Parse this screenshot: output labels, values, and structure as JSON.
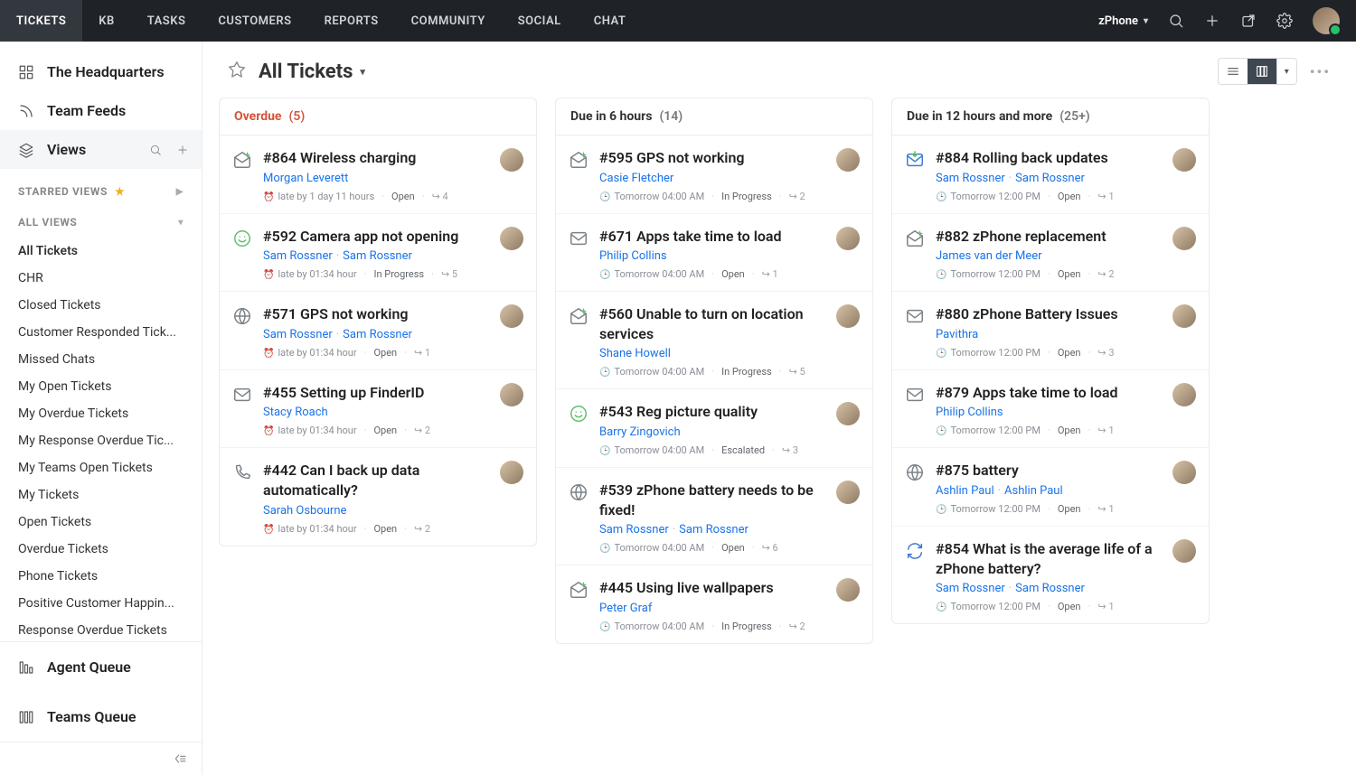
{
  "nav": {
    "tabs": [
      "TICKETS",
      "KB",
      "TASKS",
      "CUSTOMERS",
      "REPORTS",
      "COMMUNITY",
      "SOCIAL",
      "CHAT"
    ],
    "brand": "zPhone"
  },
  "sidebar": {
    "headquarters": "The Headquarters",
    "teamFeeds": "Team Feeds",
    "views": "Views",
    "starredViews": "STARRED VIEWS",
    "allViewsHeader": "ALL VIEWS",
    "allViews": [
      "All Tickets",
      "CHR",
      "Closed Tickets",
      "Customer Responded Tick...",
      "Missed Chats",
      "My Open Tickets",
      "My Overdue Tickets",
      "My Response Overdue Tic...",
      "My Teams Open Tickets",
      "My Tickets",
      "Open Tickets",
      "Overdue Tickets",
      "Phone Tickets",
      "Positive Customer Happin...",
      "Response Overdue Tickets"
    ],
    "agentQueue": "Agent Queue",
    "teamsQueue": "Teams Queue"
  },
  "header": {
    "title": "All Tickets"
  },
  "columns": [
    {
      "title": "Overdue",
      "count": "(5)",
      "overdue": true,
      "cards": [
        {
          "icon": "email-open",
          "id": "#864",
          "title": "Wireless charging",
          "assignees": [
            "Morgan Leverett"
          ],
          "late": "late by 1 day 11 hours",
          "status": "Open",
          "flag": "4"
        },
        {
          "icon": "smiley",
          "id": "#592",
          "title": "Camera app not opening",
          "assignees": [
            "Sam Rossner",
            "Sam Rossner"
          ],
          "late": "late by 01:34 hour",
          "status": "In Progress",
          "flag": "5"
        },
        {
          "icon": "globe",
          "id": "#571",
          "title": "GPS not working",
          "assignees": [
            "Sam Rossner",
            "Sam Rossner"
          ],
          "late": "late by 01:34 hour",
          "status": "Open",
          "flag": "1"
        },
        {
          "icon": "email",
          "id": "#455",
          "title": "Setting up FinderID",
          "assignees": [
            "Stacy Roach"
          ],
          "late": "late by 01:34 hour",
          "status": "Open",
          "flag": "2"
        },
        {
          "icon": "phone",
          "id": "#442",
          "title": "Can I back up data automatically?",
          "assignees": [
            "Sarah Osbourne"
          ],
          "late": "late by 01:34 hour",
          "status": "Open",
          "flag": "2"
        }
      ]
    },
    {
      "title": "Due in 6 hours",
      "count": "(14)",
      "cards": [
        {
          "icon": "email-open",
          "id": "#595",
          "title": "GPS not working",
          "assignees": [
            "Casie Fletcher"
          ],
          "due": "Tomorrow 04:00 AM",
          "status": "In Progress",
          "flag": "2"
        },
        {
          "icon": "email",
          "id": "#671",
          "title": "Apps take time to load",
          "assignees": [
            "Philip Collins"
          ],
          "due": "Tomorrow 04:00 AM",
          "status": "Open",
          "flag": "1"
        },
        {
          "icon": "email-open",
          "id": "#560",
          "title": "Unable to turn on location services",
          "assignees": [
            "Shane Howell"
          ],
          "due": "Tomorrow 04:00 AM",
          "status": "In Progress",
          "flag": "5"
        },
        {
          "icon": "smiley",
          "id": "#543",
          "title": "Reg picture quality",
          "assignees": [
            "Barry Zingovich"
          ],
          "due": "Tomorrow 04:00 AM",
          "status": "Escalated",
          "flag": "3"
        },
        {
          "icon": "globe",
          "id": "#539",
          "title": "zPhone battery needs to be fixed!",
          "assignees": [
            "Sam Rossner",
            "Sam Rossner"
          ],
          "due": "Tomorrow 04:00 AM",
          "status": "Open",
          "flag": "6"
        },
        {
          "icon": "email-open",
          "id": "#445",
          "title": "Using live wallpapers",
          "assignees": [
            "Peter Graf"
          ],
          "due": "Tomorrow 04:00 AM",
          "status": "In Progress",
          "flag": "2"
        }
      ]
    },
    {
      "title": "Due in 12 hours and more",
      "count": "(25+)",
      "cards": [
        {
          "icon": "email-down",
          "id": "#884",
          "title": "Rolling back updates",
          "assignees": [
            "Sam Rossner",
            "Sam Rossner"
          ],
          "due": "Tomorrow 12:00 PM",
          "status": "Open",
          "flag": "1"
        },
        {
          "icon": "email-open",
          "id": "#882",
          "title": "zPhone replacement",
          "assignees": [
            "James van der Meer"
          ],
          "due": "Tomorrow 12:00 PM",
          "status": "Open",
          "flag": "2"
        },
        {
          "icon": "email",
          "id": "#880",
          "title": "zPhone Battery Issues",
          "assignees": [
            "Pavithra"
          ],
          "due": "Tomorrow 12:00 PM",
          "status": "Open",
          "flag": "3"
        },
        {
          "icon": "email",
          "id": "#879",
          "title": "Apps take time to load",
          "assignees": [
            "Philip Collins"
          ],
          "due": "Tomorrow 12:00 PM",
          "status": "Open",
          "flag": "1"
        },
        {
          "icon": "globe",
          "id": "#875",
          "title": "battery",
          "assignees": [
            "Ashlin Paul",
            "Ashlin Paul"
          ],
          "due": "Tomorrow 12:00 PM",
          "status": "Open",
          "flag": "1"
        },
        {
          "icon": "refresh",
          "id": "#854",
          "title": "What is the average life of a zPhone battery?",
          "assignees": [
            "Sam Rossner",
            "Sam Rossner"
          ],
          "due": "Tomorrow 12:00 PM",
          "status": "Open",
          "flag": "1"
        }
      ]
    }
  ]
}
